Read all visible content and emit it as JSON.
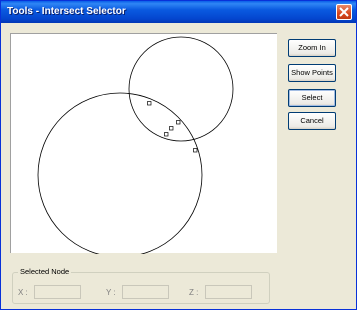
{
  "window": {
    "title": "Tools - Intersect Selector",
    "close_icon": "close-icon"
  },
  "buttons": {
    "zoom_in": "Zoom In",
    "show_points": "Show Points",
    "select": "Select",
    "cancel": "Cancel"
  },
  "selected_node": {
    "legend": "Selected Node",
    "fields": [
      {
        "label": "X :",
        "value": ""
      },
      {
        "label": "Y :",
        "value": ""
      },
      {
        "label": "Z :",
        "value": ""
      }
    ]
  },
  "colors": {
    "title_bar": "#0a5ae0",
    "close_button": "#d8461d",
    "dialog_face": "#ece9d8",
    "canvas": "#ffffff"
  }
}
